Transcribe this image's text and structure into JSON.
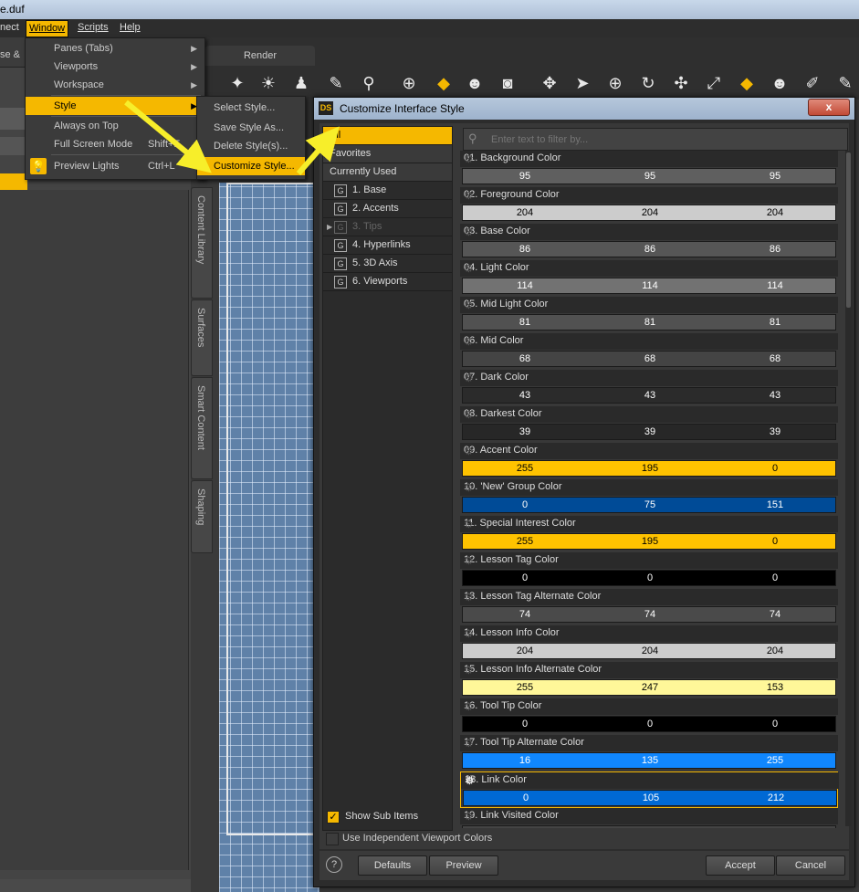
{
  "window_title": "e.duf",
  "menubar": {
    "items": [
      "nect",
      "Window",
      "Scripts",
      "Help"
    ]
  },
  "left_tabs": [
    "se &"
  ],
  "viewport_tabs": {
    "render": "Render"
  },
  "vertical_tabs": [
    "Content Library",
    "Surfaces",
    "Smart Content",
    "Shaping"
  ],
  "window_menu": {
    "items": [
      {
        "label": "Panes (Tabs)",
        "shortcut": "",
        "submenu": true
      },
      {
        "label": "Viewports",
        "shortcut": "",
        "submenu": true
      },
      {
        "label": "Workspace",
        "shortcut": "",
        "submenu": true
      },
      {
        "label": "Style",
        "shortcut": "",
        "submenu": true
      },
      {
        "label": "Always on Top",
        "shortcut": "",
        "submenu": false
      },
      {
        "label": "Full Screen Mode",
        "shortcut": "Shift+F",
        "submenu": false
      },
      {
        "label": "Preview Lights",
        "shortcut": "Ctrl+L",
        "submenu": false
      }
    ]
  },
  "style_submenu": {
    "items": [
      "Select Style...",
      "Save Style As...",
      "Delete Style(s)...",
      "Customize Style..."
    ]
  },
  "dialog": {
    "title": "Customize Interface Style",
    "icon_text": "DS",
    "close": "x",
    "categories": [
      {
        "label": "All",
        "group": false
      },
      {
        "label": "Favorites",
        "group": false
      },
      {
        "label": "Currently Used",
        "group": false
      },
      {
        "label": "1. Base",
        "group": true
      },
      {
        "label": "2. Accents",
        "group": true
      },
      {
        "label": "3. Tips",
        "group": true
      },
      {
        "label": "4. Hyperlinks",
        "group": true
      },
      {
        "label": "5. 3D Axis",
        "group": true
      },
      {
        "label": "6. Viewports",
        "group": true
      }
    ],
    "show_sub_items": "Show Sub Items",
    "filter_placeholder": "Enter text to filter by...",
    "properties": [
      {
        "name": "01. Background Color",
        "rgb": [
          95,
          95,
          95
        ],
        "color": "#5f5f5f"
      },
      {
        "name": "02. Foreground Color",
        "rgb": [
          204,
          204,
          204
        ],
        "color": "#cccccc"
      },
      {
        "name": "03. Base Color",
        "rgb": [
          86,
          86,
          86
        ],
        "color": "#565656"
      },
      {
        "name": "04. Light Color",
        "rgb": [
          114,
          114,
          114
        ],
        "color": "#727272"
      },
      {
        "name": "05. Mid Light Color",
        "rgb": [
          81,
          81,
          81
        ],
        "color": "#515151"
      },
      {
        "name": "06. Mid Color",
        "rgb": [
          68,
          68,
          68
        ],
        "color": "#444444"
      },
      {
        "name": "07. Dark Color",
        "rgb": [
          43,
          43,
          43
        ],
        "color": "#2b2b2b"
      },
      {
        "name": "08. Darkest Color",
        "rgb": [
          39,
          39,
          39
        ],
        "color": "#272727"
      },
      {
        "name": "09. Accent Color",
        "rgb": [
          255,
          195,
          0
        ],
        "color": "#ffc300"
      },
      {
        "name": "10. 'New' Group Color",
        "rgb": [
          0,
          75,
          151
        ],
        "color": "#004b97"
      },
      {
        "name": "11. Special Interest Color",
        "rgb": [
          255,
          195,
          0
        ],
        "color": "#ffc300"
      },
      {
        "name": "12. Lesson Tag Color",
        "rgb": [
          0,
          0,
          0
        ],
        "color": "#000000"
      },
      {
        "name": "13. Lesson Tag Alternate Color",
        "rgb": [
          74,
          74,
          74
        ],
        "color": "#4a4a4a"
      },
      {
        "name": "14. Lesson Info Color",
        "rgb": [
          204,
          204,
          204
        ],
        "color": "#cccccc"
      },
      {
        "name": "15. Lesson Info Alternate Color",
        "rgb": [
          255,
          247,
          153
        ],
        "color": "#fff799"
      },
      {
        "name": "16. Tool Tip Color",
        "rgb": [
          0,
          0,
          0
        ],
        "color": "#000000"
      },
      {
        "name": "17. Tool Tip Alternate Color",
        "rgb": [
          16,
          135,
          255
        ],
        "color": "#1087ff"
      },
      {
        "name": "18. Link Color",
        "rgb": [
          0,
          105,
          212
        ],
        "color": "#0069d4"
      },
      {
        "name": "19. Link Visited Color",
        "rgb": [],
        "color": "#444444"
      }
    ],
    "independent_viewport": "Use Independent Viewport Colors",
    "buttons": {
      "help": "?",
      "defaults": "Defaults",
      "preview": "Preview",
      "accept": "Accept",
      "cancel": "Cancel"
    }
  },
  "colors": {
    "accent": "#f5b800",
    "arrow": "#f7ee2a"
  }
}
